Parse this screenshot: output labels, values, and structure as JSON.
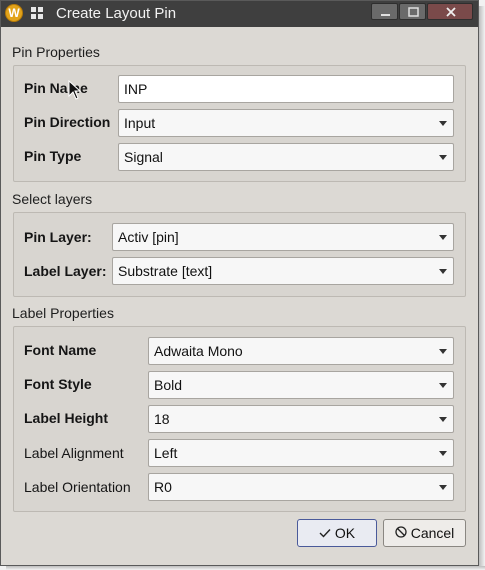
{
  "window": {
    "title": "Create Layout Pin",
    "icon_letter": "W",
    "icons": [
      "app-icon",
      "grid-icon",
      "minimize-icon",
      "maximize-icon",
      "close-icon"
    ]
  },
  "pin_properties": {
    "section_title": "Pin Properties",
    "pin_name": {
      "label": "Pin Name",
      "value": "INP"
    },
    "pin_direction": {
      "label": "Pin Direction",
      "value": "Input"
    },
    "pin_type": {
      "label": "Pin Type",
      "value": "Signal"
    }
  },
  "select_layers": {
    "section_title": "Select layers",
    "pin_layer": {
      "label": "Pin Layer:",
      "value": "Activ [pin]"
    },
    "label_layer": {
      "label": "Label Layer:",
      "value": "Substrate [text]"
    }
  },
  "label_properties": {
    "section_title": "Label Properties",
    "font_name": {
      "label": "Font Name",
      "value": "Adwaita Mono"
    },
    "font_style": {
      "label": "Font Style",
      "value": "Bold"
    },
    "label_height": {
      "label": "Label Height",
      "value": "18"
    },
    "label_alignment": {
      "label": "Label Alignment",
      "value": "Left"
    },
    "label_orientation": {
      "label": "Label Orientation",
      "value": "R0"
    }
  },
  "buttons": {
    "ok_label": "OK",
    "cancel_label": "Cancel"
  },
  "colors": {
    "titlebar": "#3f3f3f",
    "dialog_bg": "#dcd9d4",
    "default_button_border": "#4a5a9a"
  }
}
